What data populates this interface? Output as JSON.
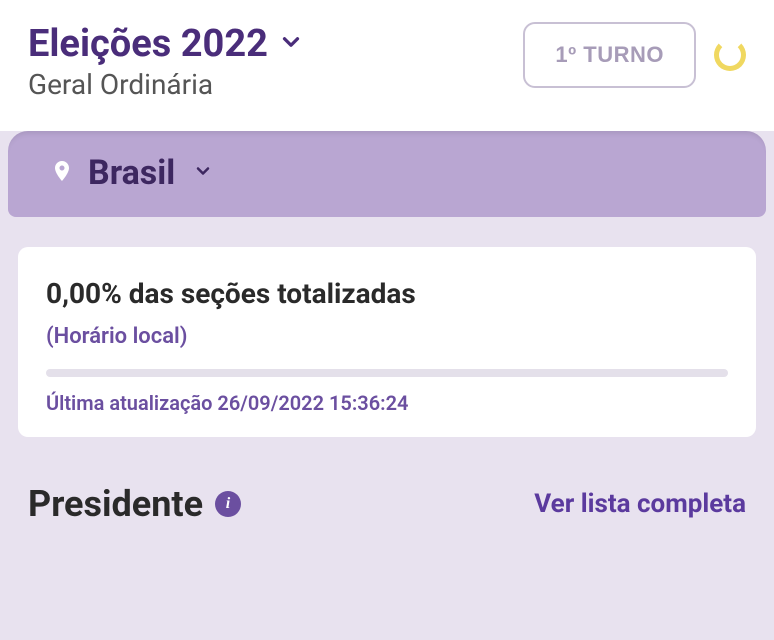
{
  "header": {
    "title": "Eleições 2022",
    "subtitle": "Geral Ordinária",
    "turno_label": "1º TURNO"
  },
  "location": {
    "name": "Brasil"
  },
  "status": {
    "sections_text": "0,00% das seções totalizadas",
    "time_note": "(Horário local)",
    "last_update_text": "Última atualização 26/09/2022 15:36:24",
    "progress_percent": 0
  },
  "race": {
    "title": "Presidente",
    "see_all": "Ver lista completa"
  }
}
